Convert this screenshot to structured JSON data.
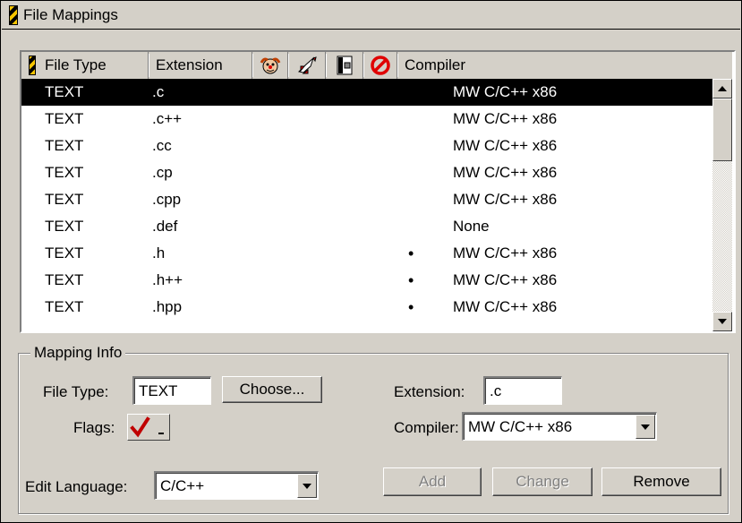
{
  "window": {
    "title": "File Mappings"
  },
  "list": {
    "columns": {
      "file_type": "File Type",
      "extension": "Extension",
      "compiler": "Compiler"
    },
    "header_icons": [
      "hazard-stripe-icon",
      "clown-face-icon",
      "rocket-icon",
      "resource-file-icon",
      "no-entry-icon"
    ],
    "rows": [
      {
        "type": "TEXT",
        "ext": ".c",
        "flag": "",
        "compiler": "MW C/C++ x86",
        "selected": true
      },
      {
        "type": "TEXT",
        "ext": ".c++",
        "flag": "",
        "compiler": "MW C/C++ x86"
      },
      {
        "type": "TEXT",
        "ext": ".cc",
        "flag": "",
        "compiler": "MW C/C++ x86"
      },
      {
        "type": "TEXT",
        "ext": ".cp",
        "flag": "",
        "compiler": "MW C/C++ x86"
      },
      {
        "type": "TEXT",
        "ext": ".cpp",
        "flag": "",
        "compiler": "MW C/C++ x86"
      },
      {
        "type": "TEXT",
        "ext": ".def",
        "flag": "",
        "compiler": "None"
      },
      {
        "type": "TEXT",
        "ext": ".h",
        "flag": "•",
        "compiler": "MW C/C++ x86"
      },
      {
        "type": "TEXT",
        "ext": ".h++",
        "flag": "•",
        "compiler": "MW C/C++ x86"
      },
      {
        "type": "TEXT",
        "ext": ".hpp",
        "flag": "•",
        "compiler": "MW C/C++ x86"
      }
    ]
  },
  "mapping_info": {
    "legend": "Mapping Info",
    "file_type_label": "File Type:",
    "file_type_value": "TEXT",
    "choose_label": "Choose...",
    "extension_label": "Extension:",
    "extension_value": ".c",
    "flags_label": "Flags:",
    "compiler_label": "Compiler:",
    "compiler_value": "MW C/C++ x86",
    "edit_language_label": "Edit Language:",
    "edit_language_value": "C/C++",
    "add_label": "Add",
    "change_label": "Change",
    "remove_label": "Remove"
  },
  "colors": {
    "hazard_yellow": "#f5c400",
    "checkmark_red": "#c00000",
    "no_entry_red": "#e00000"
  }
}
